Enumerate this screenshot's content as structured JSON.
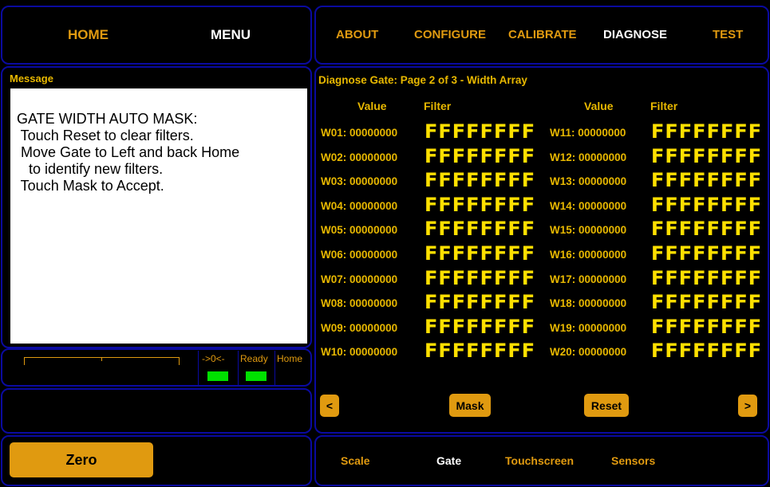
{
  "header": {
    "home": "HOME",
    "menu": "MENU"
  },
  "nav": {
    "about": "ABOUT",
    "configure": "CONFIGURE",
    "calibrate": "CALIBRATE",
    "diagnose": "DIAGNOSE",
    "test": "TEST"
  },
  "message": {
    "title": "Message",
    "text": "GATE WIDTH AUTO MASK:\n Touch Reset to clear filters.\n Move Gate to Left and back Home\n   to identify new filters.\n Touch Mask to Accept."
  },
  "status": {
    "zero_ind": "->0<-",
    "ready": "Ready",
    "home": "Home"
  },
  "diagnose": {
    "title": "Diagnose Gate: Page 2 of 3 -  Width Array",
    "col_value": "Value",
    "col_filter": "Filter",
    "left": [
      {
        "label": "W01:",
        "value": "00000000",
        "filter": "FFFFFFFF"
      },
      {
        "label": "W02:",
        "value": "00000000",
        "filter": "FFFFFFFF"
      },
      {
        "label": "W03:",
        "value": "00000000",
        "filter": "FFFFFFFF"
      },
      {
        "label": "W04:",
        "value": "00000000",
        "filter": "FFFFFFFF"
      },
      {
        "label": "W05:",
        "value": "00000000",
        "filter": "FFFFFFFF"
      },
      {
        "label": "W06:",
        "value": "00000000",
        "filter": "FFFFFFFF"
      },
      {
        "label": "W07:",
        "value": "00000000",
        "filter": "FFFFFFFF"
      },
      {
        "label": "W08:",
        "value": "00000000",
        "filter": "FFFFFFFF"
      },
      {
        "label": "W09:",
        "value": "00000000",
        "filter": "FFFFFFFF"
      },
      {
        "label": "W10:",
        "value": "00000000",
        "filter": "FFFFFFFF"
      }
    ],
    "right": [
      {
        "label": "W11:",
        "value": "00000000",
        "filter": "FFFFFFFF"
      },
      {
        "label": "W12:",
        "value": "00000000",
        "filter": "FFFFFFFF"
      },
      {
        "label": "W13:",
        "value": "00000000",
        "filter": "FFFFFFFF"
      },
      {
        "label": "W14:",
        "value": "00000000",
        "filter": "FFFFFFFF"
      },
      {
        "label": "W15:",
        "value": "00000000",
        "filter": "FFFFFFFF"
      },
      {
        "label": "W16:",
        "value": "00000000",
        "filter": "FFFFFFFF"
      },
      {
        "label": "W17:",
        "value": "00000000",
        "filter": "FFFFFFFF"
      },
      {
        "label": "W18:",
        "value": "00000000",
        "filter": "FFFFFFFF"
      },
      {
        "label": "W19:",
        "value": "00000000",
        "filter": "FFFFFFFF"
      },
      {
        "label": "W20:",
        "value": "00000000",
        "filter": "FFFFFFFF"
      }
    ]
  },
  "buttons": {
    "prev": "<",
    "mask": "Mask",
    "reset": "Reset",
    "next": ">",
    "zero": "Zero"
  },
  "bottom_nav": {
    "scale": "Scale",
    "gate": "Gate",
    "touchscreen": "Touchscreen",
    "sensors": "Sensors"
  }
}
